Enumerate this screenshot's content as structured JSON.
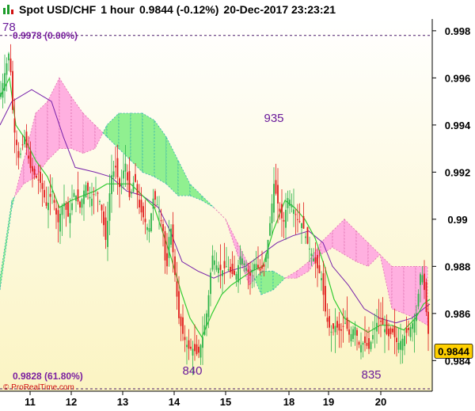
{
  "header": {
    "symbol": "Spot USD/CHF",
    "timeframe": "1 hour",
    "quote": "0.9844 (-0.12%)",
    "datetime": "20-Dec-2017 23:23:21"
  },
  "watermark": "© ProRealTime.com",
  "colors": {
    "up_candle": "#2db34a",
    "down_candle": "#e01b1b",
    "cloud_bull": "#90f090",
    "cloud_bear": "#ffb0e0",
    "tenkan": "#33cc33",
    "kijun": "#7722aa",
    "price_box": "#ffd000"
  },
  "chart_data": {
    "type": "candlestick",
    "y_ticks": [
      "0.998",
      "0.996",
      "0.994",
      "0.992",
      "0.99",
      "0.988",
      "0.986",
      "0.984"
    ],
    "x_ticks": [
      "11",
      "12",
      "13",
      "14",
      "15",
      "18",
      "19",
      "20"
    ],
    "ylim": [
      0.9827,
      0.9985
    ],
    "last_price": "0.9844",
    "annotations": [
      {
        "text": "78",
        "value": 0.9978
      },
      {
        "text": "935",
        "value": 0.9935
      },
      {
        "text": "840",
        "value": 0.984
      },
      {
        "text": "835",
        "value": 0.9835
      }
    ],
    "levels": [
      {
        "label": "0.9978 (0.00%)",
        "value": 0.9978
      },
      {
        "label": "0.9828 (61.80%)",
        "value": 0.9828
      }
    ],
    "close_path": [
      [
        0,
        0.9952
      ],
      [
        6,
        0.9962
      ],
      [
        12,
        0.9972
      ],
      [
        17,
        0.994
      ],
      [
        24,
        0.9925
      ],
      [
        31,
        0.9935
      ],
      [
        38,
        0.9922
      ],
      [
        45,
        0.9918
      ],
      [
        52,
        0.9915
      ],
      [
        59,
        0.9905
      ],
      [
        66,
        0.9912
      ],
      [
        73,
        0.9898
      ],
      [
        80,
        0.9908
      ],
      [
        87,
        0.99
      ],
      [
        94,
        0.9912
      ],
      [
        101,
        0.9905
      ],
      [
        108,
        0.9915
      ],
      [
        115,
        0.9908
      ],
      [
        122,
        0.9913
      ],
      [
        128,
        0.9905
      ],
      [
        134,
        0.989
      ],
      [
        140,
        0.9918
      ],
      [
        146,
        0.9922
      ],
      [
        152,
        0.9912
      ],
      [
        158,
        0.9925
      ],
      [
        164,
        0.9908
      ],
      [
        170,
        0.9918
      ],
      [
        176,
        0.9905
      ],
      [
        182,
        0.99
      ],
      [
        188,
        0.9895
      ],
      [
        194,
        0.991
      ],
      [
        200,
        0.9905
      ],
      [
        206,
        0.9895
      ],
      [
        210,
        0.9875
      ],
      [
        215,
        0.99
      ],
      [
        220,
        0.988
      ],
      [
        226,
        0.9858
      ],
      [
        232,
        0.985
      ],
      [
        238,
        0.9845
      ],
      [
        244,
        0.9845
      ],
      [
        250,
        0.9842
      ],
      [
        256,
        0.985
      ],
      [
        262,
        0.9862
      ],
      [
        268,
        0.9885
      ],
      [
        274,
        0.988
      ],
      [
        280,
        0.9878
      ],
      [
        286,
        0.988
      ],
      [
        292,
        0.9877
      ],
      [
        298,
        0.9876
      ],
      [
        304,
        0.9885
      ],
      [
        310,
        0.988
      ],
      [
        316,
        0.9876
      ],
      [
        322,
        0.9882
      ],
      [
        328,
        0.9878
      ],
      [
        334,
        0.988
      ],
      [
        340,
        0.9895
      ],
      [
        346,
        0.9915
      ],
      [
        352,
        0.9905
      ],
      [
        358,
        0.9898
      ],
      [
        364,
        0.991
      ],
      [
        370,
        0.9905
      ],
      [
        376,
        0.99
      ],
      [
        382,
        0.9898
      ],
      [
        388,
        0.989
      ],
      [
        394,
        0.9885
      ],
      [
        400,
        0.988
      ],
      [
        406,
        0.9875
      ],
      [
        412,
        0.9858
      ],
      [
        418,
        0.9852
      ],
      [
        424,
        0.9855
      ],
      [
        430,
        0.9852
      ],
      [
        436,
        0.9856
      ],
      [
        442,
        0.985
      ],
      [
        448,
        0.9855
      ],
      [
        454,
        0.9846
      ],
      [
        460,
        0.9848
      ],
      [
        466,
        0.9845
      ],
      [
        472,
        0.9852
      ],
      [
        478,
        0.9858
      ],
      [
        484,
        0.9855
      ],
      [
        490,
        0.985
      ],
      [
        496,
        0.9852
      ],
      [
        502,
        0.9847
      ],
      [
        508,
        0.9849
      ],
      [
        514,
        0.9852
      ],
      [
        520,
        0.9855
      ],
      [
        526,
        0.986
      ],
      [
        532,
        0.988
      ],
      [
        536,
        0.987
      ],
      [
        540,
        0.9855
      ],
      [
        543,
        0.9844
      ]
    ],
    "tenkan": [
      [
        0,
        0.9952
      ],
      [
        12,
        0.996
      ],
      [
        20,
        0.994
      ],
      [
        30,
        0.9935
      ],
      [
        45,
        0.9925
      ],
      [
        60,
        0.9918
      ],
      [
        75,
        0.9905
      ],
      [
        90,
        0.9908
      ],
      [
        105,
        0.991
      ],
      [
        120,
        0.9912
      ],
      [
        135,
        0.9915
      ],
      [
        150,
        0.9915
      ],
      [
        165,
        0.9915
      ],
      [
        180,
        0.991
      ],
      [
        195,
        0.9905
      ],
      [
        205,
        0.9895
      ],
      [
        215,
        0.9885
      ],
      [
        228,
        0.987
      ],
      [
        240,
        0.9858
      ],
      [
        255,
        0.985
      ],
      [
        268,
        0.986
      ],
      [
        280,
        0.9868
      ],
      [
        292,
        0.9872
      ],
      [
        305,
        0.9875
      ],
      [
        318,
        0.9878
      ],
      [
        332,
        0.988
      ],
      [
        345,
        0.9895
      ],
      [
        360,
        0.9908
      ],
      [
        372,
        0.9905
      ],
      [
        385,
        0.99
      ],
      [
        398,
        0.9892
      ],
      [
        410,
        0.988
      ],
      [
        422,
        0.9866
      ],
      [
        435,
        0.9858
      ],
      [
        450,
        0.9855
      ],
      [
        465,
        0.9852
      ],
      [
        480,
        0.9855
      ],
      [
        495,
        0.9855
      ],
      [
        510,
        0.9853
      ],
      [
        525,
        0.9858
      ],
      [
        535,
        0.9864
      ],
      [
        543,
        0.9866
      ]
    ],
    "kijun": [
      [
        0,
        0.994
      ],
      [
        15,
        0.995
      ],
      [
        40,
        0.9955
      ],
      [
        65,
        0.995
      ],
      [
        80,
        0.9935
      ],
      [
        95,
        0.9922
      ],
      [
        120,
        0.992
      ],
      [
        140,
        0.9918
      ],
      [
        160,
        0.9912
      ],
      [
        180,
        0.991
      ],
      [
        200,
        0.9905
      ],
      [
        215,
        0.9895
      ],
      [
        230,
        0.9882
      ],
      [
        250,
        0.9878
      ],
      [
        270,
        0.9875
      ],
      [
        290,
        0.9878
      ],
      [
        310,
        0.988
      ],
      [
        330,
        0.9885
      ],
      [
        350,
        0.989
      ],
      [
        370,
        0.9893
      ],
      [
        390,
        0.9895
      ],
      [
        408,
        0.989
      ],
      [
        420,
        0.988
      ],
      [
        440,
        0.9872
      ],
      [
        460,
        0.9862
      ],
      [
        480,
        0.9858
      ],
      [
        500,
        0.9856
      ],
      [
        520,
        0.9858
      ],
      [
        535,
        0.9862
      ],
      [
        543,
        0.9864
      ]
    ],
    "cloud": [
      [
        0,
        0.987,
        0.9875
      ],
      [
        15,
        0.9905,
        0.9908
      ],
      [
        30,
        0.9925,
        0.9915
      ],
      [
        45,
        0.9945,
        0.9918
      ],
      [
        60,
        0.995,
        0.9925
      ],
      [
        75,
        0.996,
        0.993
      ],
      [
        90,
        0.9952,
        0.993
      ],
      [
        105,
        0.9945,
        0.9928
      ],
      [
        120,
        0.994,
        0.993
      ],
      [
        135,
        0.9935,
        0.994
      ],
      [
        150,
        0.993,
        0.9945
      ],
      [
        165,
        0.9925,
        0.9945
      ],
      [
        180,
        0.992,
        0.9945
      ],
      [
        195,
        0.9918,
        0.9942
      ],
      [
        210,
        0.9915,
        0.9935
      ],
      [
        225,
        0.991,
        0.9925
      ],
      [
        240,
        0.991,
        0.9915
      ],
      [
        255,
        0.9908,
        0.991
      ],
      [
        270,
        0.9905,
        0.9905
      ],
      [
        285,
        0.99,
        0.99
      ],
      [
        300,
        0.989,
        0.9885
      ],
      [
        315,
        0.988,
        0.9872
      ],
      [
        330,
        0.9868,
        0.9878
      ],
      [
        345,
        0.987,
        0.9878
      ],
      [
        360,
        0.9875,
        0.9875
      ],
      [
        375,
        0.9878,
        0.9875
      ],
      [
        390,
        0.9882,
        0.9878
      ],
      [
        405,
        0.989,
        0.9885
      ],
      [
        420,
        0.9895,
        0.9888
      ],
      [
        435,
        0.99,
        0.9885
      ],
      [
        450,
        0.9895,
        0.9882
      ],
      [
        465,
        0.989,
        0.988
      ],
      [
        480,
        0.9885,
        0.9885
      ],
      [
        495,
        0.988,
        0.9862
      ],
      [
        510,
        0.988,
        0.986
      ],
      [
        525,
        0.988,
        0.9858
      ],
      [
        540,
        0.988,
        0.9855
      ]
    ]
  }
}
